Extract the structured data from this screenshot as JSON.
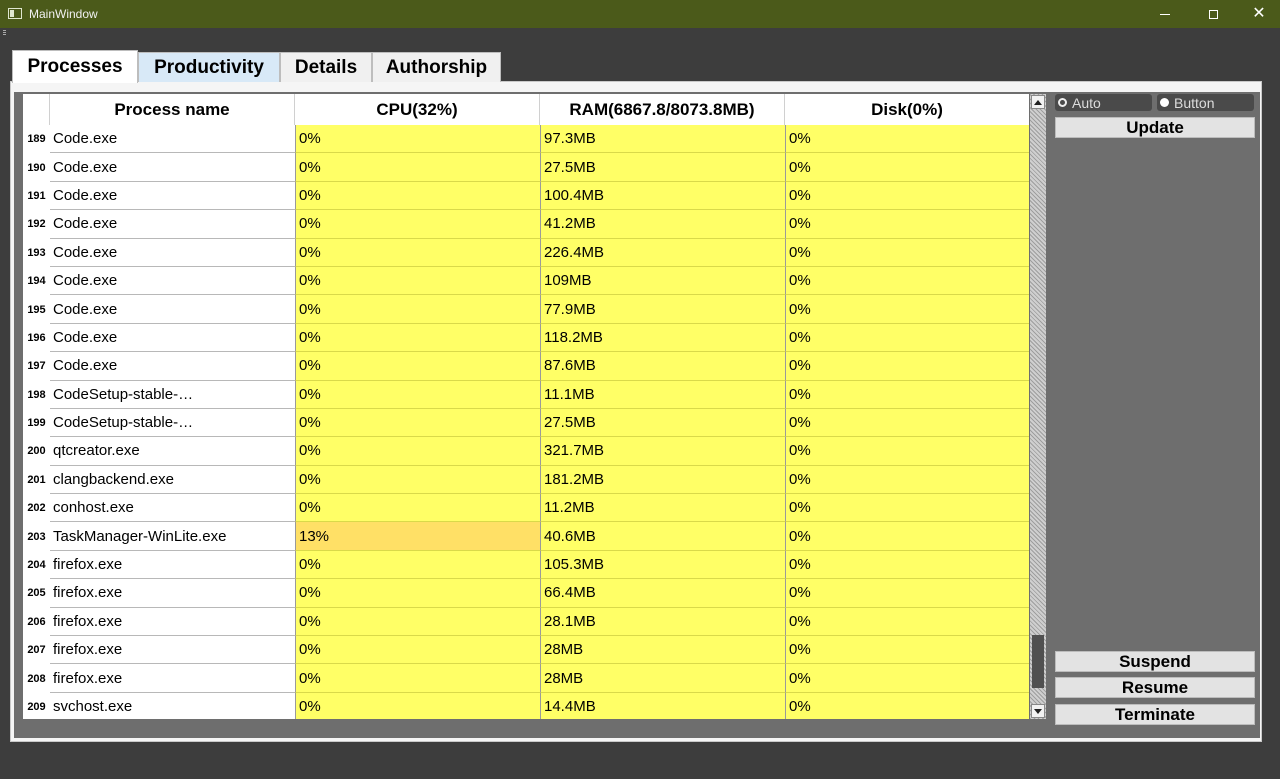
{
  "window": {
    "title": "MainWindow",
    "close_glyph": "✕"
  },
  "tabs": [
    {
      "label": "Processes",
      "active": true
    },
    {
      "label": "Productivity",
      "active": false
    },
    {
      "label": "Details",
      "active": false
    },
    {
      "label": "Authorship",
      "active": false
    }
  ],
  "table": {
    "headers": {
      "name": "Process name",
      "cpu": "CPU(32%)",
      "ram": "RAM(6867.8/8073.8MB)",
      "disk": "Disk(0%)"
    },
    "rows": [
      {
        "idx": "189",
        "name": "Code.exe",
        "cpu": "0%",
        "ram": "97.3MB",
        "disk": "0%"
      },
      {
        "idx": "190",
        "name": "Code.exe",
        "cpu": "0%",
        "ram": "27.5MB",
        "disk": "0%"
      },
      {
        "idx": "191",
        "name": "Code.exe",
        "cpu": "0%",
        "ram": "100.4MB",
        "disk": "0%"
      },
      {
        "idx": "192",
        "name": "Code.exe",
        "cpu": "0%",
        "ram": "41.2MB",
        "disk": "0%"
      },
      {
        "idx": "193",
        "name": "Code.exe",
        "cpu": "0%",
        "ram": "226.4MB",
        "disk": "0%"
      },
      {
        "idx": "194",
        "name": "Code.exe",
        "cpu": "0%",
        "ram": "109MB",
        "disk": "0%"
      },
      {
        "idx": "195",
        "name": "Code.exe",
        "cpu": "0%",
        "ram": "77.9MB",
        "disk": "0%"
      },
      {
        "idx": "196",
        "name": "Code.exe",
        "cpu": "0%",
        "ram": "118.2MB",
        "disk": "0%"
      },
      {
        "idx": "197",
        "name": "Code.exe",
        "cpu": "0%",
        "ram": "87.6MB",
        "disk": "0%"
      },
      {
        "idx": "198",
        "name": "CodeSetup-stable-…",
        "cpu": "0%",
        "ram": "11.1MB",
        "disk": "0%"
      },
      {
        "idx": "199",
        "name": "CodeSetup-stable-…",
        "cpu": "0%",
        "ram": "27.5MB",
        "disk": "0%"
      },
      {
        "idx": "200",
        "name": "qtcreator.exe",
        "cpu": "0%",
        "ram": "321.7MB",
        "disk": "0%"
      },
      {
        "idx": "201",
        "name": "clangbackend.exe",
        "cpu": "0%",
        "ram": "181.2MB",
        "disk": "0%"
      },
      {
        "idx": "202",
        "name": "conhost.exe",
        "cpu": "0%",
        "ram": "11.2MB",
        "disk": "0%"
      },
      {
        "idx": "203",
        "name": "TaskManager-WinLite.exe",
        "cpu": "13%",
        "ram": "40.6MB",
        "disk": "0%",
        "hot": true
      },
      {
        "idx": "204",
        "name": "firefox.exe",
        "cpu": "0%",
        "ram": "105.3MB",
        "disk": "0%"
      },
      {
        "idx": "205",
        "name": "firefox.exe",
        "cpu": "0%",
        "ram": "66.4MB",
        "disk": "0%"
      },
      {
        "idx": "206",
        "name": "firefox.exe",
        "cpu": "0%",
        "ram": "28.1MB",
        "disk": "0%"
      },
      {
        "idx": "207",
        "name": "firefox.exe",
        "cpu": "0%",
        "ram": "28MB",
        "disk": "0%"
      },
      {
        "idx": "208",
        "name": "firefox.exe",
        "cpu": "0%",
        "ram": "28MB",
        "disk": "0%"
      },
      {
        "idx": "209",
        "name": "svchost.exe",
        "cpu": "0%",
        "ram": "14.4MB",
        "disk": "0%"
      }
    ]
  },
  "update_mode": {
    "auto_label": "Auto",
    "button_label": "Button",
    "selected": "Button"
  },
  "buttons": {
    "update": "Update",
    "suspend": "Suspend",
    "resume": "Resume",
    "terminate": "Terminate"
  },
  "colors": {
    "cell_bg": "#ffff66",
    "cell_hot_bg": "#ffe066",
    "titlebar": "#4b5a1a"
  }
}
